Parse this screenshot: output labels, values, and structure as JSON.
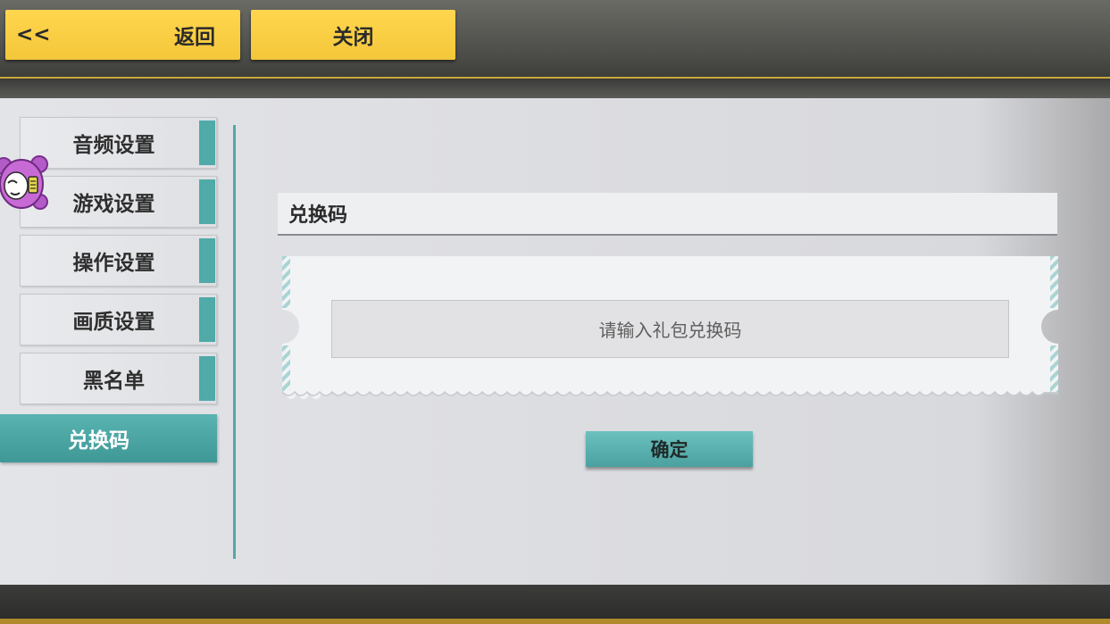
{
  "header": {
    "back_arrow": "<<",
    "back_label": "返回",
    "close_label": "关闭"
  },
  "sidebar": {
    "items": [
      {
        "label": "音频设置"
      },
      {
        "label": "游戏设置"
      },
      {
        "label": "操作设置"
      },
      {
        "label": "画质设置"
      },
      {
        "label": "黑名单"
      },
      {
        "label": "兑换码",
        "active": true
      }
    ]
  },
  "main": {
    "section_title": "兑换码",
    "input_placeholder": "请输入礼包兑换码",
    "confirm_label": "确定"
  },
  "colors": {
    "accent_teal": "#4faaa8",
    "button_yellow": "#f4c73a",
    "gold_stripe": "#c9a93c"
  },
  "icons": {
    "mascot": "mascot-avatar-icon"
  }
}
